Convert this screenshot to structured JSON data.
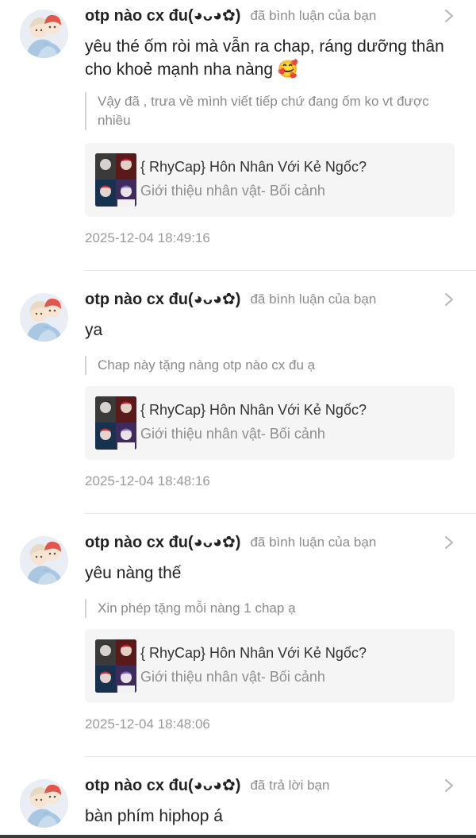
{
  "notifications": [
    {
      "user": "otp nào cx đu(◕ᴗ◕✿)",
      "action": "đã bình luận của bạn",
      "text": "yêu thé ốm ròi mà vẫn ra chap, ráng dưỡng thân cho khoẻ mạnh nha nàng 🥰",
      "quote": "Vậy đã , trưa về mình viết tiếp chứ đang ốm ko vt được nhiều",
      "card": {
        "title": "{ RhyCap} Hôn Nhân Với Kẻ Ngốc?",
        "subtitle": "Giới thiệu nhân vật- Bối cảnh"
      },
      "time": "2025-12-04 18:49:16"
    },
    {
      "user": "otp nào cx đu(◕ᴗ◕✿)",
      "action": "đã bình luận của bạn",
      "text": "ya",
      "quote": "Chap này tặng nàng otp nào cx đu ạ",
      "card": {
        "title": "{ RhyCap} Hôn Nhân Với Kẻ Ngốc?",
        "subtitle": "Giới thiệu nhân vật- Bối cảnh"
      },
      "time": "2025-12-04 18:48:16"
    },
    {
      "user": "otp nào cx đu(◕ᴗ◕✿)",
      "action": "đã bình luận của bạn",
      "text": "yêu nàng thế",
      "quote": "Xin phép tặng mỗi nàng 1 chap ạ",
      "card": {
        "title": "{ RhyCap} Hôn Nhân Với Kẻ Ngốc?",
        "subtitle": "Giới thiệu nhân vật- Bối cảnh"
      },
      "time": "2025-12-04 18:48:06"
    },
    {
      "user": "otp nào cx đu(◕ᴗ◕✿)",
      "action": "đã trả lời bạn",
      "text": "bàn phím hiphop á"
    }
  ]
}
